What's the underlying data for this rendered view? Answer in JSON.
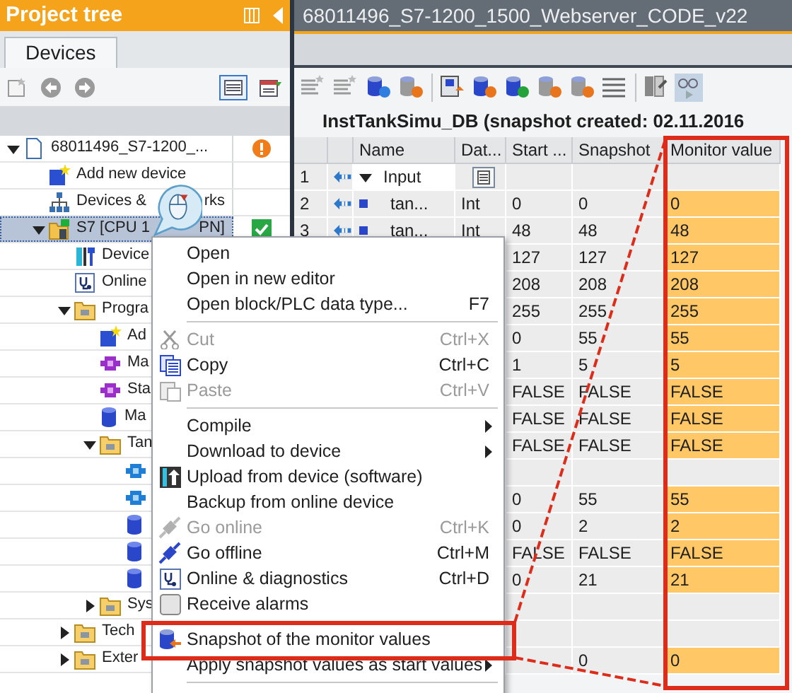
{
  "project_tree": {
    "title": "Project tree",
    "tabs": [
      {
        "label": "Devices",
        "selected": true
      }
    ],
    "items": [
      {
        "kind": "project",
        "label": "68011496_S7-1200_...",
        "status_warning": true,
        "expanded": true,
        "selected": false,
        "children": [
          {
            "kind": "add",
            "label": "Add new device",
            "selected": false
          },
          {
            "kind": "network",
            "label": "Devices &",
            "label_tail": "rks",
            "selected": false
          },
          {
            "kind": "cpu",
            "label": "S7 [CPU 1",
            "label_tail": "PN]",
            "status_ok": true,
            "expanded": true,
            "selected": true,
            "children": [
              {
                "kind": "config",
                "label": "Device",
                "selected": false
              },
              {
                "kind": "diagnostics",
                "label": "Online",
                "selected": false
              },
              {
                "kind": "folder",
                "label": "Progra",
                "expanded": true,
                "selected": false,
                "children": [
                  {
                    "kind": "add",
                    "label": "Ad",
                    "selected": false
                  },
                  {
                    "kind": "ob",
                    "label": "Ma",
                    "selected": false
                  },
                  {
                    "kind": "ob",
                    "label": "Sta",
                    "selected": false
                  },
                  {
                    "kind": "db",
                    "label": "Ma",
                    "selected": false
                  },
                  {
                    "kind": "folder",
                    "label": "Tan",
                    "expanded": true,
                    "selected": false,
                    "children": [
                      {
                        "kind": "fb",
                        "selected": false
                      },
                      {
                        "kind": "fb",
                        "selected": false
                      },
                      {
                        "kind": "db",
                        "selected": false
                      },
                      {
                        "kind": "db",
                        "selected": false
                      },
                      {
                        "kind": "db",
                        "selected": false
                      }
                    ]
                  },
                  {
                    "kind": "folder",
                    "label": "Sys",
                    "expanded": false,
                    "selected": false
                  }
                ]
              },
              {
                "kind": "folder",
                "label": "Tech",
                "expanded": false,
                "selected": false
              },
              {
                "kind": "folder",
                "label": "Exter",
                "expanded": false,
                "selected": false
              }
            ]
          }
        ]
      }
    ]
  },
  "editor": {
    "title": "68011496_S7-1200_1500_Webserver_CODE_v22",
    "block_title": "InstTankSimu_DB (snapshot created: 02.11.2016",
    "columns": [
      "Name",
      "Dat...",
      "Start ...",
      "Snapshot",
      "Monitor value"
    ],
    "rows": [
      {
        "kind": "struct",
        "number": "1",
        "name": "Input",
        "expanded": true
      },
      {
        "kind": "value",
        "number": "2",
        "name": "tan...",
        "data_type": "Int",
        "start": "0",
        "snapshot": "0",
        "monitor": "0"
      },
      {
        "kind": "value",
        "number": "3",
        "name": "tan...",
        "data_type": "Int",
        "start": "48",
        "snapshot": "48",
        "monitor": "48"
      },
      {
        "kind": "value",
        "start": "127",
        "snapshot": "127",
        "monitor": "127"
      },
      {
        "kind": "value",
        "start": "208",
        "snapshot": "208",
        "monitor": "208"
      },
      {
        "kind": "value",
        "start": "255",
        "snapshot": "255",
        "monitor": "255"
      },
      {
        "kind": "value",
        "start": "0",
        "snapshot": "55",
        "monitor": "55"
      },
      {
        "kind": "value",
        "start": "1",
        "snapshot": "5",
        "monitor": "5"
      },
      {
        "kind": "value",
        "start": "FALSE",
        "snapshot": "FALSE",
        "monitor": "FALSE"
      },
      {
        "kind": "value",
        "start": "FALSE",
        "snapshot": "FALSE",
        "monitor": "FALSE"
      },
      {
        "kind": "value",
        "start": "FALSE",
        "snapshot": "FALSE",
        "monitor": "FALSE"
      },
      {
        "kind": "empty"
      },
      {
        "kind": "value",
        "start": "0",
        "snapshot": "55",
        "monitor": "55"
      },
      {
        "kind": "value",
        "start": "0",
        "snapshot": "2",
        "monitor": "2"
      },
      {
        "kind": "value",
        "start": "FALSE",
        "snapshot": "FALSE",
        "monitor": "FALSE"
      },
      {
        "kind": "value",
        "start": "0",
        "snapshot": "21",
        "monitor": "21"
      },
      {
        "kind": "empty"
      },
      {
        "kind": "empty"
      },
      {
        "kind": "value",
        "snapshot": "0",
        "monitor": "0"
      }
    ]
  },
  "context_menu": {
    "items": [
      {
        "kind": "item",
        "label": "Open",
        "disabled": false
      },
      {
        "kind": "item",
        "label": "Open in new editor",
        "disabled": false
      },
      {
        "kind": "item",
        "label": "Open block/PLC data type...",
        "shortcut": "F7",
        "disabled": false
      },
      {
        "kind": "separator"
      },
      {
        "kind": "item",
        "label": "Cut",
        "shortcut": "Ctrl+X",
        "disabled": true
      },
      {
        "kind": "item",
        "label": "Copy",
        "shortcut": "Ctrl+C",
        "disabled": false
      },
      {
        "kind": "item",
        "label": "Paste",
        "shortcut": "Ctrl+V",
        "disabled": true
      },
      {
        "kind": "separator"
      },
      {
        "kind": "item",
        "label": "Compile",
        "submenu": true,
        "disabled": false
      },
      {
        "kind": "item",
        "label": "Download to device",
        "submenu": true,
        "disabled": false
      },
      {
        "kind": "item",
        "label": "Upload from device (software)",
        "disabled": false
      },
      {
        "kind": "item",
        "label": "Backup from online device",
        "disabled": false
      },
      {
        "kind": "item",
        "label": "Go online",
        "shortcut": "Ctrl+K",
        "disabled": true
      },
      {
        "kind": "item",
        "label": "Go offline",
        "shortcut": "Ctrl+M",
        "disabled": false
      },
      {
        "kind": "item",
        "label": "Online & diagnostics",
        "shortcut": "Ctrl+D",
        "disabled": false
      },
      {
        "kind": "item",
        "label": "Receive alarms",
        "disabled": false
      },
      {
        "kind": "separator"
      },
      {
        "kind": "item",
        "label": "Snapshot of the monitor values",
        "disabled": false
      },
      {
        "kind": "item",
        "label": "Apply snapshot values as start values",
        "submenu": true,
        "disabled": false
      },
      {
        "kind": "separator"
      }
    ]
  }
}
